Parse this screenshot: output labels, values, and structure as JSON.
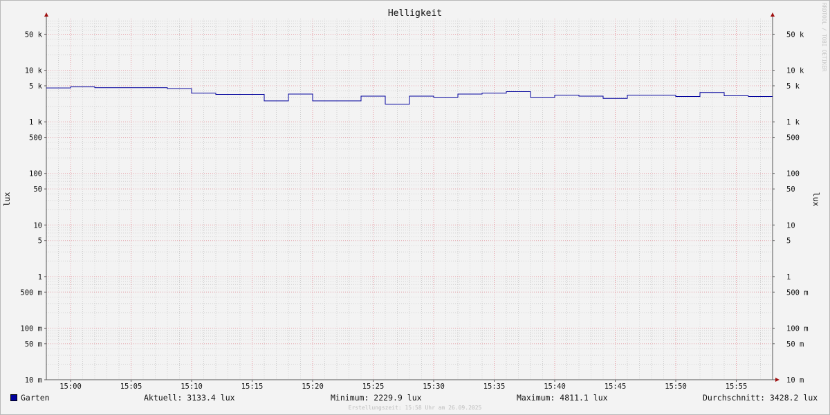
{
  "chart_data": {
    "type": "line",
    "title": "Helligkeit",
    "ylabel": "lux",
    "ylabel_right": "lux",
    "yscale": "log",
    "ylim": [
      0.01,
      100000
    ],
    "xlim": [
      "14:58",
      "15:58"
    ],
    "x_ticks": [
      "15:00",
      "15:05",
      "15:10",
      "15:15",
      "15:20",
      "15:25",
      "15:30",
      "15:35",
      "15:40",
      "15:45",
      "15:50",
      "15:55"
    ],
    "y_ticks": [
      {
        "value": 0.01,
        "label": "10 m"
      },
      {
        "value": 0.05,
        "label": "50 m"
      },
      {
        "value": 0.1,
        "label": "100 m"
      },
      {
        "value": 0.5,
        "label": "500 m"
      },
      {
        "value": 1,
        "label": "1"
      },
      {
        "value": 5,
        "label": "5"
      },
      {
        "value": 10,
        "label": "10"
      },
      {
        "value": 50,
        "label": "50"
      },
      {
        "value": 100,
        "label": "100"
      },
      {
        "value": 500,
        "label": "500"
      },
      {
        "value": 1000,
        "label": "1 k"
      },
      {
        "value": 5000,
        "label": "5 k"
      },
      {
        "value": 10000,
        "label": "10 k"
      },
      {
        "value": 50000,
        "label": "50 k"
      }
    ],
    "grid": true,
    "series": [
      {
        "name": "Garten",
        "color": "#00009c",
        "x": [
          "14:58",
          "15:00",
          "15:02",
          "15:04",
          "15:06",
          "15:08",
          "15:10",
          "15:12",
          "15:14",
          "15:16",
          "15:18",
          "15:20",
          "15:22",
          "15:24",
          "15:26",
          "15:28",
          "15:30",
          "15:32",
          "15:34",
          "15:36",
          "15:38",
          "15:40",
          "15:42",
          "15:44",
          "15:46",
          "15:48",
          "15:50",
          "15:52",
          "15:54",
          "15:56",
          "15:58"
        ],
        "values": [
          4550,
          4750,
          4600,
          4600,
          4600,
          4400,
          3600,
          3400,
          3400,
          2550,
          3450,
          2550,
          2550,
          3150,
          2200,
          3150,
          3000,
          3450,
          3600,
          3850,
          3000,
          3300,
          3150,
          2850,
          3300,
          3300,
          3100,
          3700,
          3200,
          3100,
          3100
        ]
      }
    ]
  },
  "legend": {
    "label": "Garten",
    "current": "Aktuell: 3133.4 lux",
    "minimum": "Minimum: 2229.9 lux",
    "maximum": "Maximum: 4811.1 lux",
    "average": "Durchschnitt: 3428.2 lux"
  },
  "footer": "Erstellungszeit: 15:58 Uhr am 26.09.2025",
  "credit": "RRDTOOL / TOBI OETIKER",
  "colors": {
    "series": "#00009c",
    "major_grid": "#e8a0a8",
    "minor_grid": "#c8c8c8",
    "axis": "#555555",
    "arrow": "#a01010"
  }
}
